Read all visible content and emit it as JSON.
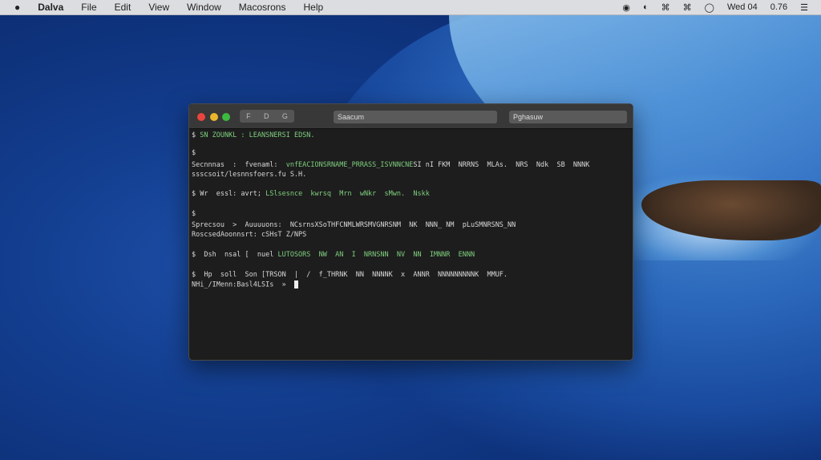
{
  "menubar": {
    "apple": "",
    "items": [
      "Dalva",
      "File",
      "Edit",
      "View",
      "Window",
      "Macosrons",
      "Help"
    ],
    "status": [
      "battery-icon",
      "wifi-icon",
      "bluetooth-icon",
      "volume-icon",
      "clock-icon"
    ],
    "date": "Wed 04",
    "time": "0.76"
  },
  "window": {
    "toolbar_buttons": [
      "F",
      "D",
      "G"
    ],
    "search1": "Saacum",
    "search2": "Pghasuw",
    "lines": [
      [
        {
          "t": "$ "
        },
        {
          "t": "SN ZOUNKL : LEANSNERSI EDSN.",
          "g": true
        }
      ],
      [
        {
          "t": "$"
        }
      ],
      [
        {
          "t": "Secnnnas  :  fvenaml:  "
        },
        {
          "t": "vnfEACIONSRNAME_PRRASS_ISVNNCNE",
          "g": true
        },
        {
          "t": "SI nI FKM  NRRNS  MLAs.  NRS  Ndk  SB  NNNK"
        }
      ],
      [
        {
          "t": "ssscsoit/lesnnsfoers.fu S.H."
        }
      ],
      [
        {
          "t": "$ Wr  essl: avrt; "
        },
        {
          "t": "LSlsesnce  kwrsq  Mrn  wNkr  sMwn.  Nskk",
          "g": true
        }
      ],
      [
        {
          "t": "$"
        }
      ],
      [
        {
          "t": "Sprecsou  >  Auuuuons:  NCsrnsXSoTHFCNMLWRSMVGNRSNM  NK  NNN_ NM  pLuSMNRSNS_NN"
        }
      ],
      [
        {
          "t": "RoscsedAoonnsrt: cSHsT Z/NPS"
        }
      ],
      [
        {
          "t": "$  Dsh  nsal [  nuel "
        },
        {
          "t": "LUTOSORS  NW  AN  I  NRNSNN  NV  NN  IMNNR  ENNN",
          "g": true
        }
      ],
      [
        {
          "t": "$  Hp  soll  Son [TRSON  |  /  f_THRNK  NN  NNNNK  x  ANNR  NNNNNNNNNK  MMUF."
        }
      ],
      [
        {
          "t": "NHi_/IMenn:Basl4LSIs  »  "
        }
      ]
    ]
  }
}
